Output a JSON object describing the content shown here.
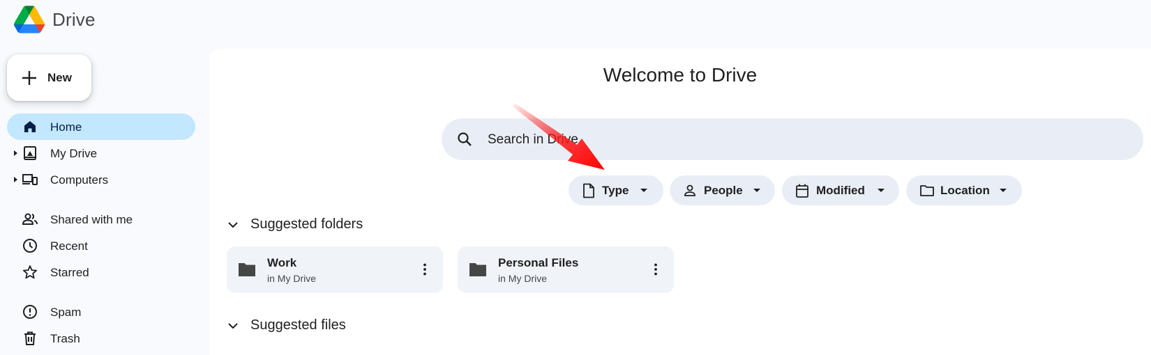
{
  "app": {
    "name": "Drive",
    "logo_icon": "google-drive-logo"
  },
  "new_button": {
    "label": "New",
    "icon": "plus-icon"
  },
  "sidebar": {
    "items": [
      {
        "label": "Home",
        "icon": "home-icon",
        "active": true
      },
      {
        "label": "My Drive",
        "icon": "my-drive-icon",
        "expandable": true
      },
      {
        "label": "Computers",
        "icon": "computers-icon",
        "expandable": true
      },
      {
        "label": "Shared with me",
        "icon": "shared-people-icon"
      },
      {
        "label": "Recent",
        "icon": "clock-icon"
      },
      {
        "label": "Starred",
        "icon": "star-icon"
      },
      {
        "label": "Spam",
        "icon": "spam-icon"
      },
      {
        "label": "Trash",
        "icon": "trash-icon"
      }
    ]
  },
  "main": {
    "title": "Welcome to Drive",
    "search": {
      "placeholder": "Search in Drive",
      "icon": "search-icon"
    },
    "filters": [
      {
        "label": "Type",
        "icon": "file-icon"
      },
      {
        "label": "People",
        "icon": "person-icon"
      },
      {
        "label": "Modified",
        "icon": "calendar-icon"
      },
      {
        "label": "Location",
        "icon": "folder-outline-icon"
      }
    ],
    "suggested_folders": {
      "title": "Suggested folders",
      "items": [
        {
          "name": "Work",
          "location": "in My Drive"
        },
        {
          "name": "Personal Files",
          "location": "in My Drive"
        }
      ]
    },
    "suggested_files": {
      "title": "Suggested files"
    }
  },
  "colors": {
    "page_bg": "#f8fafd",
    "panel_bg": "#ffffff",
    "active_nav_bg": "#c2e7ff",
    "search_bg": "#e9eef6",
    "card_bg": "#f0f4f9",
    "annotation_arrow": "#ff0000"
  }
}
